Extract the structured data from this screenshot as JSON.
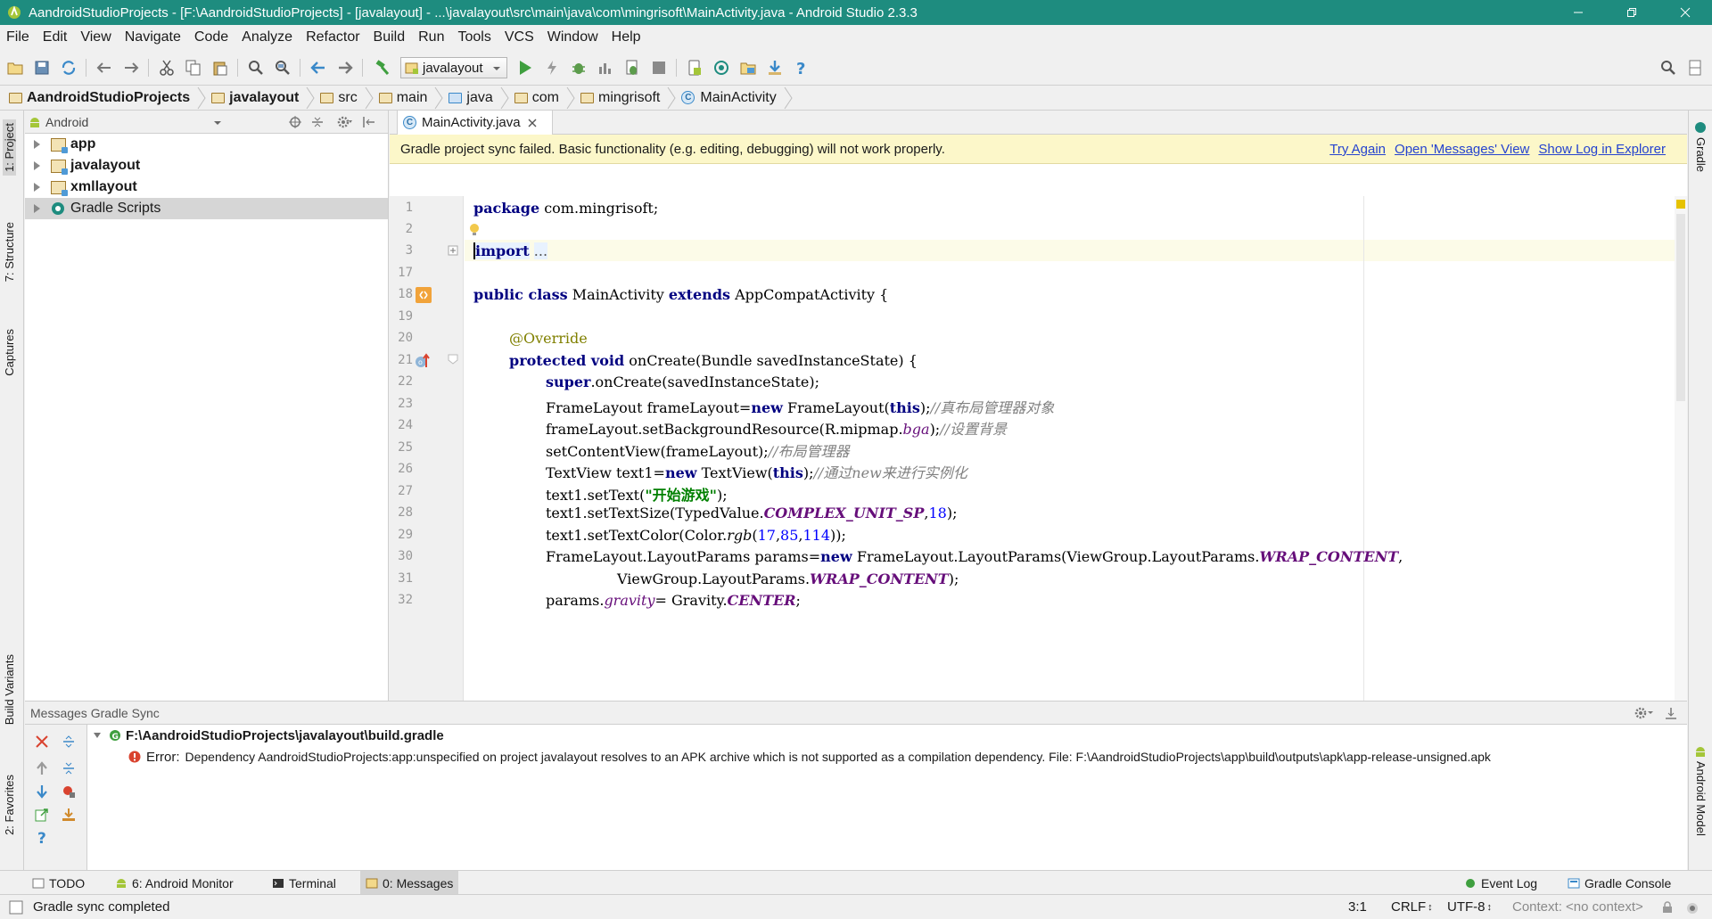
{
  "window": {
    "title": "AandroidStudioProjects - [F:\\AandroidStudioProjects] - [javalayout] - ...\\javalayout\\src\\main\\java\\com\\mingrisoft\\MainActivity.java - Android Studio 2.3.3",
    "accent": "#1e8c7f"
  },
  "menubar": [
    {
      "label": "File"
    },
    {
      "label": "Edit"
    },
    {
      "label": "View"
    },
    {
      "label": "Navigate"
    },
    {
      "label": "Code"
    },
    {
      "label": "Analyze"
    },
    {
      "label": "Refactor"
    },
    {
      "label": "Build"
    },
    {
      "label": "Run"
    },
    {
      "label": "Tools"
    },
    {
      "label": "VCS"
    },
    {
      "label": "Window"
    },
    {
      "label": "Help"
    }
  ],
  "toolbar": {
    "run_config": "javalayout"
  },
  "breadcrumbs": [
    {
      "label": "AandroidStudioProjects",
      "bold": true
    },
    {
      "label": "javalayout",
      "bold": true
    },
    {
      "label": "src"
    },
    {
      "label": "main"
    },
    {
      "label": "java"
    },
    {
      "label": "com"
    },
    {
      "label": "mingrisoft"
    },
    {
      "label": "MainActivity"
    }
  ],
  "left_stripe": {
    "project": "1: Project",
    "structure": "7: Structure",
    "captures": "Captures",
    "build_variants": "Build Variants",
    "favorites": "2: Favorites"
  },
  "right_stripe": {
    "gradle": "Gradle",
    "android_model": "Android Model"
  },
  "project_panel": {
    "view_mode": "Android",
    "items": [
      {
        "label": "app",
        "bold": true
      },
      {
        "label": "javalayout",
        "bold": true
      },
      {
        "label": "xmllayout",
        "bold": true
      },
      {
        "label": "Gradle Scripts",
        "bold": false
      }
    ]
  },
  "editor": {
    "tab_label": "MainActivity.java",
    "banner": {
      "message": "Gradle project sync failed. Basic functionality (e.g. editing, debugging) will not work properly.",
      "try_again": "Try Again",
      "open_messages": "Open 'Messages' View",
      "show_log": "Show Log in Explorer"
    },
    "line_numbers": [
      "1",
      "2",
      "3",
      "17",
      "18",
      "19",
      "20",
      "21",
      "22",
      "23",
      "24",
      "25",
      "26",
      "27",
      "28",
      "29",
      "30",
      "31",
      "32"
    ],
    "code": {
      "l1_kw": "package",
      "l1_rest": " com.mingrisoft;",
      "l3_kw": "import",
      "l3_dots": "...",
      "l18_kw1": "public class",
      "l18_name": " MainActivity ",
      "l18_kw2": "extends",
      "l18_rest": " AppCompatActivity {",
      "l20_ann": "@Override",
      "l21_kw": "protected void",
      "l21_rest": " onCreate(Bundle savedInstanceState) {",
      "l22_kw": "super",
      "l22_rest": ".onCreate(savedInstanceState);",
      "l23_a": "FrameLayout frameLayout=",
      "l23_kw": "new",
      "l23_b": " FrameLayout(",
      "l23_kw2": "this",
      "l23_c": ");",
      "l23_cm": "//真布局管理器对象",
      "l24_a": "frameLayout.setBackgroundResource(R.mipmap.",
      "l24_fld": "bga",
      "l24_b": ");",
      "l24_cm": "//设置背景",
      "l25_a": "setContentView(frameLayout);",
      "l25_cm": "//布局管理器",
      "l26_a": "TextView text1=",
      "l26_kw": "new",
      "l26_b": " TextView(",
      "l26_kw2": "this",
      "l26_c": ");",
      "l26_cm": "//通过new来进行实例化",
      "l27_a": "text1.setText(",
      "l27_str": "\"开始游戏\"",
      "l27_b": ");",
      "l28_a": "text1.setTextSize(TypedValue.",
      "l28_sf": "COMPLEX_UNIT_SP",
      "l28_b": ",",
      "l28_num": "18",
      "l28_c": ");",
      "l29_a": "text1.setTextColor(Color.",
      "l29_it": "rgb",
      "l29_b": "(",
      "l29_n1": "17",
      "l29_c1": ",",
      "l29_n2": "85",
      "l29_c2": ",",
      "l29_n3": "114",
      "l29_d": "));",
      "l30_a": "FrameLayout.LayoutParams params=",
      "l30_kw": "new",
      "l30_b": " FrameLayout.LayoutParams(ViewGroup.LayoutParams.",
      "l30_sf": "WRAP_CONTENT",
      "l30_c": ",",
      "l31_a": "ViewGroup.LayoutParams.",
      "l31_sf": "WRAP_CONTENT",
      "l31_b": ");",
      "l32_a": "params.",
      "l32_fld": "gravity",
      "l32_b": "= Gravity.",
      "l32_sf": "CENTER",
      "l32_c": ";"
    }
  },
  "messages_panel": {
    "title": "Messages Gradle Sync",
    "file": "F:\\AandroidStudioProjects\\javalayout\\build.gradle",
    "error_label": "Error:",
    "error_text": "Dependency AandroidStudioProjects:app:unspecified on project javalayout resolves to an APK archive which is not supported as a compilation dependency. File: F:\\AandroidStudioProjects\\app\\build\\outputs\\apk\\app-release-unsigned.apk"
  },
  "bottom_tools": {
    "todo": "TODO",
    "android_monitor": "6: Android Monitor",
    "terminal": "Terminal",
    "messages": "0: Messages",
    "event_log": "Event Log",
    "gradle_console": "Gradle Console"
  },
  "status_bar": {
    "message": "Gradle sync completed",
    "position": "3:1",
    "line_sep": "CRLF",
    "encoding": "UTF-8",
    "context": "Context: <no context>"
  }
}
